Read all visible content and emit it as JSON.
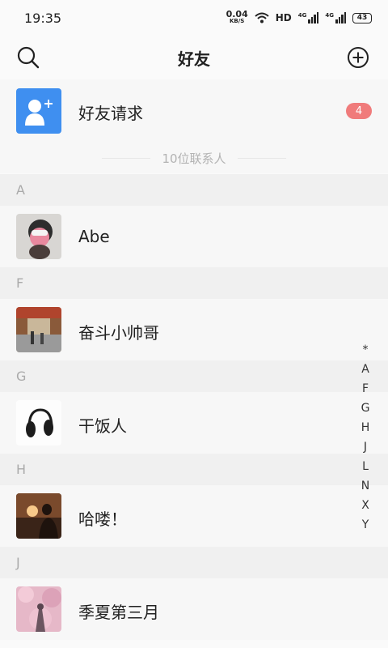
{
  "status_bar": {
    "time": "19:35",
    "net_speed_value": "0.04",
    "net_speed_unit": "KB/S",
    "hd_label": "HD",
    "signal_1": "4G",
    "signal_2": "4G",
    "battery": "43"
  },
  "header": {
    "title": "好友",
    "icons": {
      "left": "search-icon",
      "right": "add-circle-icon"
    }
  },
  "friend_requests": {
    "label": "好友请求",
    "badge": "4",
    "icon": "add-user-icon",
    "accent_color": "#3f8ff0",
    "badge_color": "#f07b7b"
  },
  "contact_count": "10位联系人",
  "sections": [
    {
      "letter": "A",
      "contacts": [
        {
          "name": "Abe"
        }
      ]
    },
    {
      "letter": "F",
      "contacts": [
        {
          "name": "奋斗小帅哥"
        }
      ]
    },
    {
      "letter": "G",
      "contacts": [
        {
          "name": "干饭人"
        }
      ]
    },
    {
      "letter": "H",
      "contacts": [
        {
          "name": "哈喽！"
        }
      ]
    },
    {
      "letter": "J",
      "contacts": [
        {
          "name": "季夏第三月"
        }
      ]
    }
  ],
  "index_letters": [
    "*",
    "A",
    "F",
    "G",
    "H",
    "J",
    "L",
    "N",
    "X",
    "Y"
  ]
}
